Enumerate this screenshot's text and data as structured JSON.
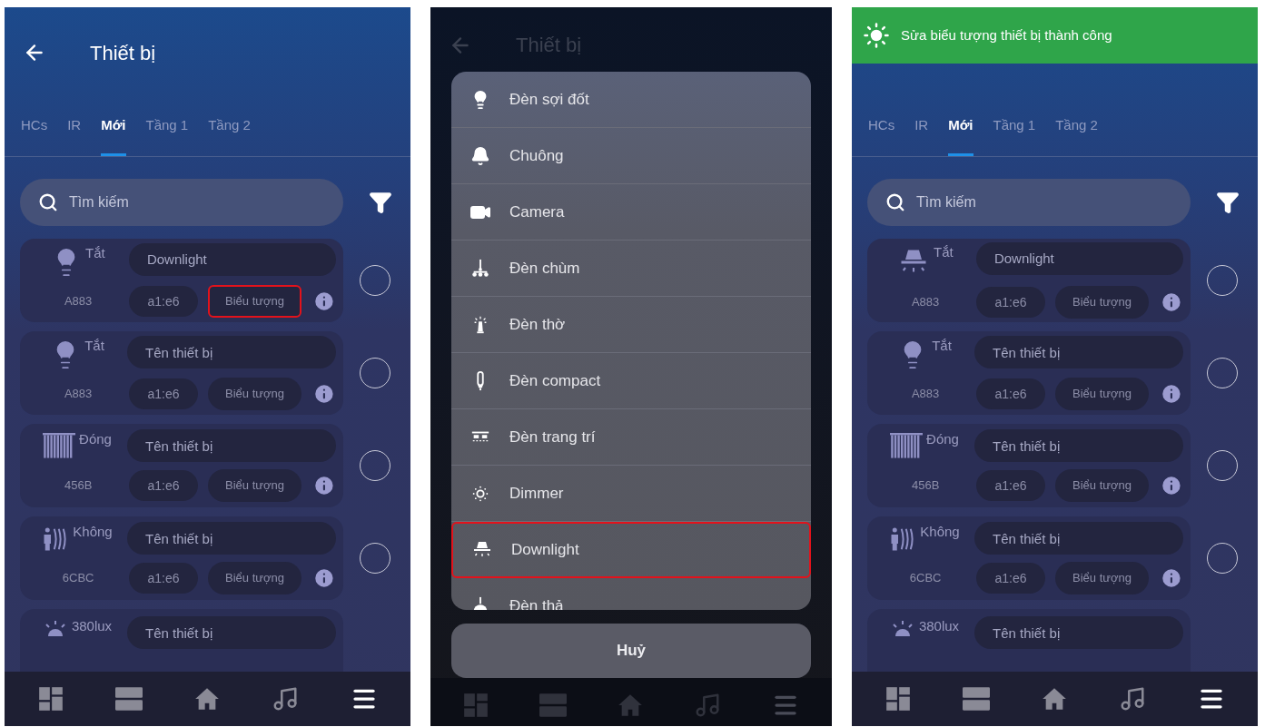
{
  "screens": [
    {
      "kind": "list",
      "header": {
        "title": "Thiết bị"
      },
      "tabs": [
        {
          "label": "HCs",
          "selected": false
        },
        {
          "label": "IR",
          "selected": false
        },
        {
          "label": "Mới",
          "selected": true
        },
        {
          "label": "Tầng 1",
          "selected": false
        },
        {
          "label": "Tầng 2",
          "selected": false
        }
      ],
      "search": {
        "placeholder": "Tìm kiếm"
      },
      "devices": [
        {
          "kind": "bulb",
          "status": "Tắt",
          "name": {
            "value": "Downlight"
          },
          "code": "A883",
          "address": "a1:e6",
          "icon_label": "Biểu tượng",
          "highlighted": true,
          "selected": false
        },
        {
          "kind": "bulb",
          "status": "Tắt",
          "name": {
            "placeholder": "Tên thiết bị"
          },
          "code": "A883",
          "address": "a1:e6",
          "icon_label": "Biểu tượng",
          "highlighted": false,
          "selected": false
        },
        {
          "kind": "curtain",
          "status": "Đóng",
          "name": {
            "placeholder": "Tên thiết bị"
          },
          "code": "456B",
          "address": "a1:e6",
          "icon_label": "Biểu tượng",
          "highlighted": false,
          "selected": false
        },
        {
          "kind": "presence",
          "status": "Không",
          "name": {
            "placeholder": "Tên thiết bị"
          },
          "code": "6CBC",
          "address": "a1:e6",
          "icon_label": "Biểu tượng",
          "highlighted": false,
          "selected": false
        },
        {
          "kind": "lux",
          "status": "380lux",
          "name": {
            "placeholder": "Tên thiết bị"
          }
        }
      ],
      "nav": [
        {
          "kind": "dashboard",
          "selected": false
        },
        {
          "kind": "rooms",
          "selected": false
        },
        {
          "kind": "home",
          "selected": false
        },
        {
          "kind": "music",
          "selected": false
        },
        {
          "kind": "menu",
          "selected": true
        }
      ]
    },
    {
      "kind": "picker",
      "header": {
        "title": "Thiết bị"
      },
      "sheet": {
        "items": [
          {
            "kind": "bulb",
            "label": "Đèn sợi đốt",
            "highlighted": false
          },
          {
            "kind": "bell",
            "label": "Chuông",
            "highlighted": false
          },
          {
            "kind": "camera",
            "label": "Camera",
            "highlighted": false
          },
          {
            "kind": "chandelier",
            "label": "Đèn chùm",
            "highlighted": false
          },
          {
            "kind": "altar",
            "label": "Đèn thờ",
            "highlighted": false
          },
          {
            "kind": "compact",
            "label": "Đèn compact",
            "highlighted": false
          },
          {
            "kind": "decor",
            "label": "Đèn trang trí",
            "highlighted": false
          },
          {
            "kind": "dimmer",
            "label": "Dimmer",
            "highlighted": false
          },
          {
            "kind": "downlight",
            "label": "Downlight",
            "highlighted": true
          },
          {
            "kind": "pendant",
            "label": "Đèn thả",
            "highlighted": false
          }
        ],
        "cancel": "Huỷ"
      },
      "nav": [
        {
          "kind": "dashboard",
          "selected": false
        },
        {
          "kind": "rooms",
          "selected": false
        },
        {
          "kind": "home",
          "selected": false
        },
        {
          "kind": "music",
          "selected": false
        },
        {
          "kind": "menu",
          "selected": true
        }
      ]
    },
    {
      "kind": "list",
      "toast": {
        "text": "Sửa biểu tượng thiết bị thành công"
      },
      "tabs": [
        {
          "label": "HCs",
          "selected": false
        },
        {
          "label": "IR",
          "selected": false
        },
        {
          "label": "Mới",
          "selected": true
        },
        {
          "label": "Tầng 1",
          "selected": false
        },
        {
          "label": "Tầng 2",
          "selected": false
        }
      ],
      "search": {
        "placeholder": "Tìm kiếm"
      },
      "devices": [
        {
          "kind": "downlight",
          "status": "Tắt",
          "name": {
            "value": "Downlight"
          },
          "code": "A883",
          "address": "a1:e6",
          "icon_label": "Biểu tượng",
          "highlighted": false,
          "selected": false
        },
        {
          "kind": "bulb",
          "status": "Tắt",
          "name": {
            "placeholder": "Tên thiết bị"
          },
          "code": "A883",
          "address": "a1:e6",
          "icon_label": "Biểu tượng",
          "highlighted": false,
          "selected": false
        },
        {
          "kind": "curtain",
          "status": "Đóng",
          "name": {
            "placeholder": "Tên thiết bị"
          },
          "code": "456B",
          "address": "a1:e6",
          "icon_label": "Biểu tượng",
          "highlighted": false,
          "selected": false
        },
        {
          "kind": "presence",
          "status": "Không",
          "name": {
            "placeholder": "Tên thiết bị"
          },
          "code": "6CBC",
          "address": "a1:e6",
          "icon_label": "Biểu tượng",
          "highlighted": false,
          "selected": false
        },
        {
          "kind": "lux",
          "status": "380lux",
          "name": {
            "placeholder": "Tên thiết bị"
          }
        }
      ],
      "nav": [
        {
          "kind": "dashboard",
          "selected": false
        },
        {
          "kind": "rooms",
          "selected": false
        },
        {
          "kind": "home",
          "selected": false
        },
        {
          "kind": "music",
          "selected": false
        },
        {
          "kind": "menu",
          "selected": true
        }
      ]
    }
  ]
}
